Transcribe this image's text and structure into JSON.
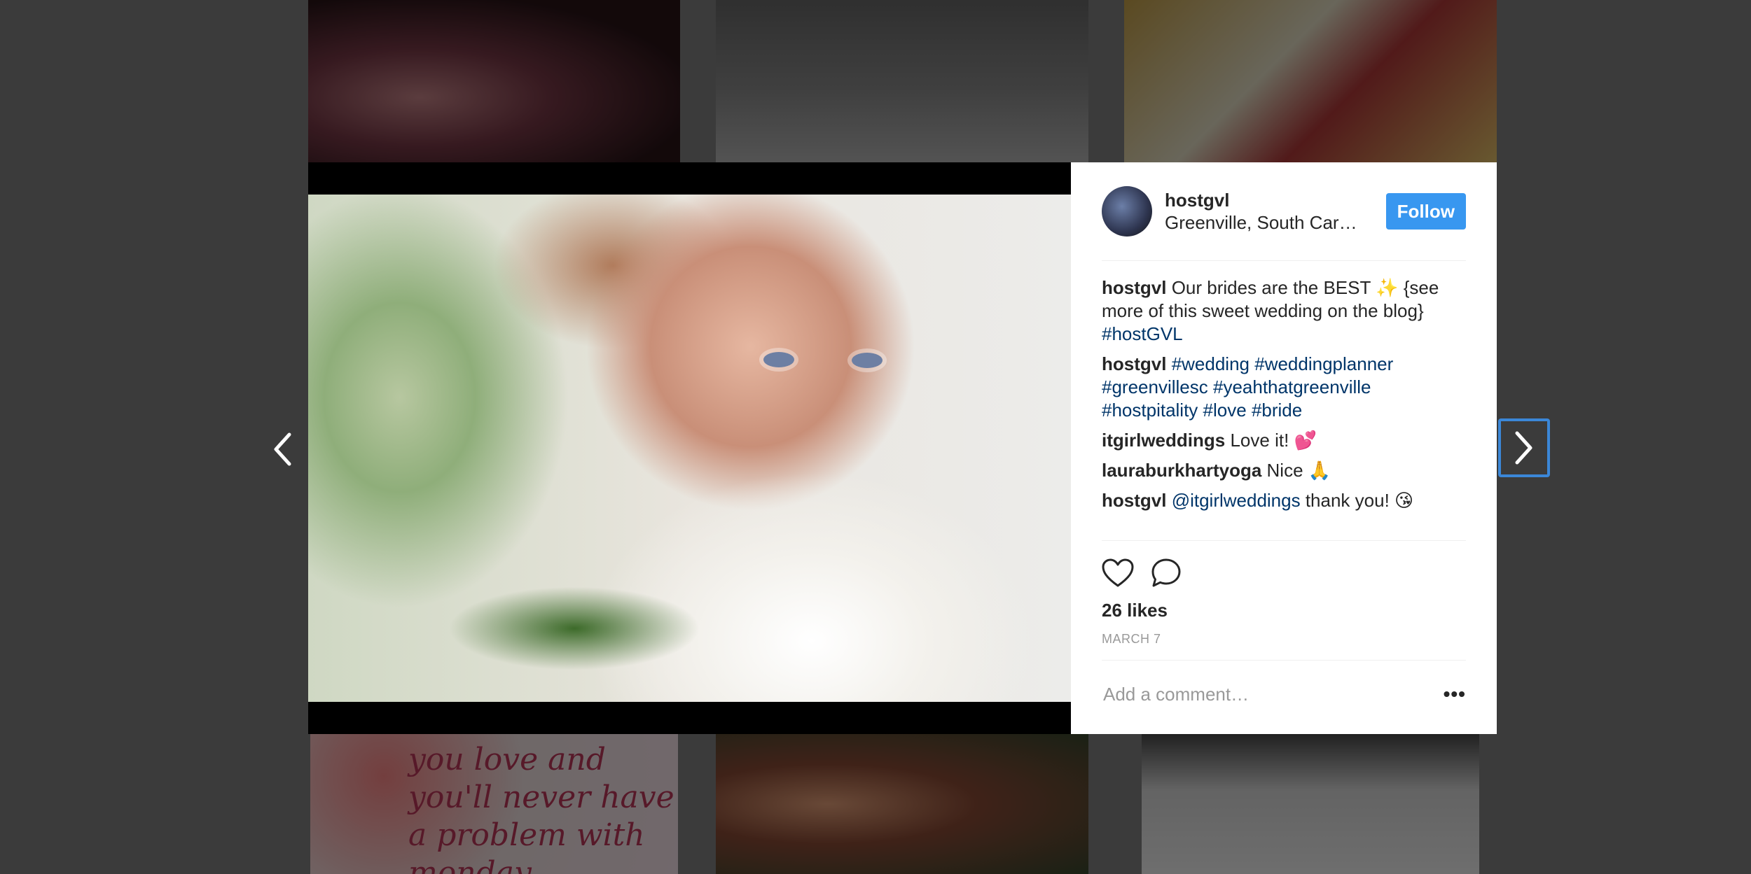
{
  "background_tiles": {
    "bottom_left_text": "you love and you'll never have a problem with monday"
  },
  "post": {
    "username": "hostgvl",
    "location": "Greenville, South Carolina",
    "follow_label": "Follow",
    "comments": [
      {
        "author": "hostgvl",
        "segments": [
          {
            "text": "Our brides are the BEST ✨ {see more of this sweet wedding on the blog} ",
            "type": "text"
          },
          {
            "text": "#hostGVL",
            "type": "tag"
          }
        ]
      },
      {
        "author": "hostgvl",
        "segments": [
          {
            "text": "#wedding",
            "type": "tag"
          },
          {
            "text": " ",
            "type": "text"
          },
          {
            "text": "#weddingplanner",
            "type": "tag"
          },
          {
            "text": " ",
            "type": "text"
          },
          {
            "text": "#greenvillesc",
            "type": "tag"
          },
          {
            "text": " ",
            "type": "text"
          },
          {
            "text": "#yeahthatgreenville",
            "type": "tag"
          },
          {
            "text": " ",
            "type": "text"
          },
          {
            "text": "#hostpitality",
            "type": "tag"
          },
          {
            "text": " ",
            "type": "text"
          },
          {
            "text": "#love",
            "type": "tag"
          },
          {
            "text": " ",
            "type": "text"
          },
          {
            "text": "#bride",
            "type": "tag"
          }
        ]
      },
      {
        "author": "itgirlweddings",
        "segments": [
          {
            "text": "Love it! 💕",
            "type": "text"
          }
        ]
      },
      {
        "author": "lauraburkhartyoga",
        "segments": [
          {
            "text": "Nice 🙏",
            "type": "text"
          }
        ]
      },
      {
        "author": "hostgvl",
        "segments": [
          {
            "text": "@itgirlweddings",
            "type": "tag"
          },
          {
            "text": " thank you! 😘",
            "type": "text"
          }
        ]
      }
    ],
    "likes": "26 likes",
    "date": "MARCH 7",
    "add_comment_placeholder": "Add a comment…",
    "more_label": "•••"
  },
  "icons": {
    "prev": "chevron-left-icon",
    "next": "chevron-right-icon",
    "like": "heart-icon",
    "comment": "speech-bubble-icon"
  },
  "colors": {
    "follow_button": "#3897f0",
    "hashtag": "#003569",
    "overlay": "#3b3b3b",
    "focus_ring": "#3b87d8"
  }
}
